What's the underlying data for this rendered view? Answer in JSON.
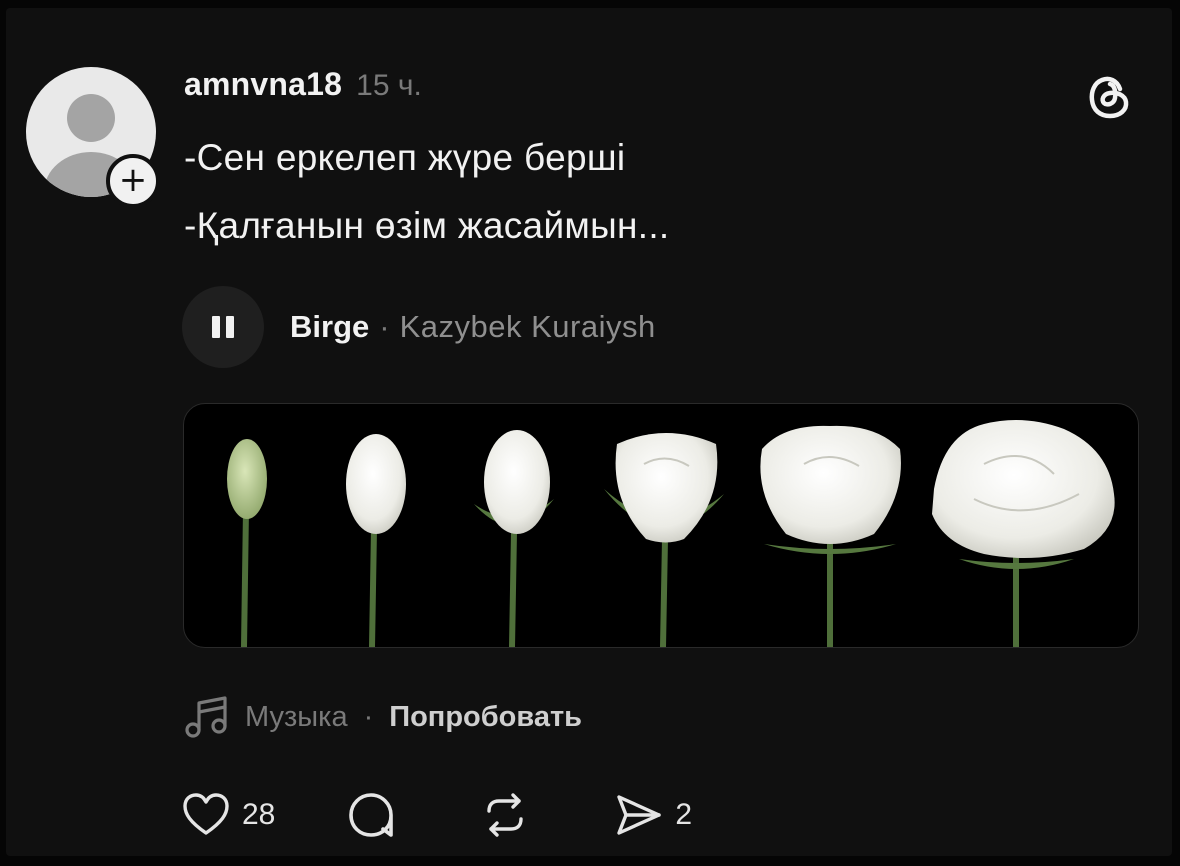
{
  "post": {
    "username": "amnvna18",
    "timestamp": "15 ч.",
    "lines": [
      "-Сен еркелеп жүре берші",
      "-Қалғанын өзім жасаймын..."
    ]
  },
  "music": {
    "track_title": "Birge",
    "separator": "·",
    "artist": "Kazybek Kuraiysh",
    "state": "playing"
  },
  "footer": {
    "label": "Музыка",
    "separator": "·",
    "action": "Попробовать"
  },
  "actions": {
    "likes": "28",
    "comments": "",
    "reposts": "",
    "shares": "2"
  },
  "icons": {
    "app_logo": "threads-logo-icon",
    "avatar": "default-avatar",
    "follow": "plus-icon",
    "music": "music-note-icon",
    "like": "heart-icon",
    "comment": "comment-bubble-icon",
    "repost": "repost-icon",
    "share": "send-icon"
  },
  "colors": {
    "background": "#101010",
    "text_primary": "#f2f2f2",
    "text_secondary": "#7a7a7a"
  }
}
